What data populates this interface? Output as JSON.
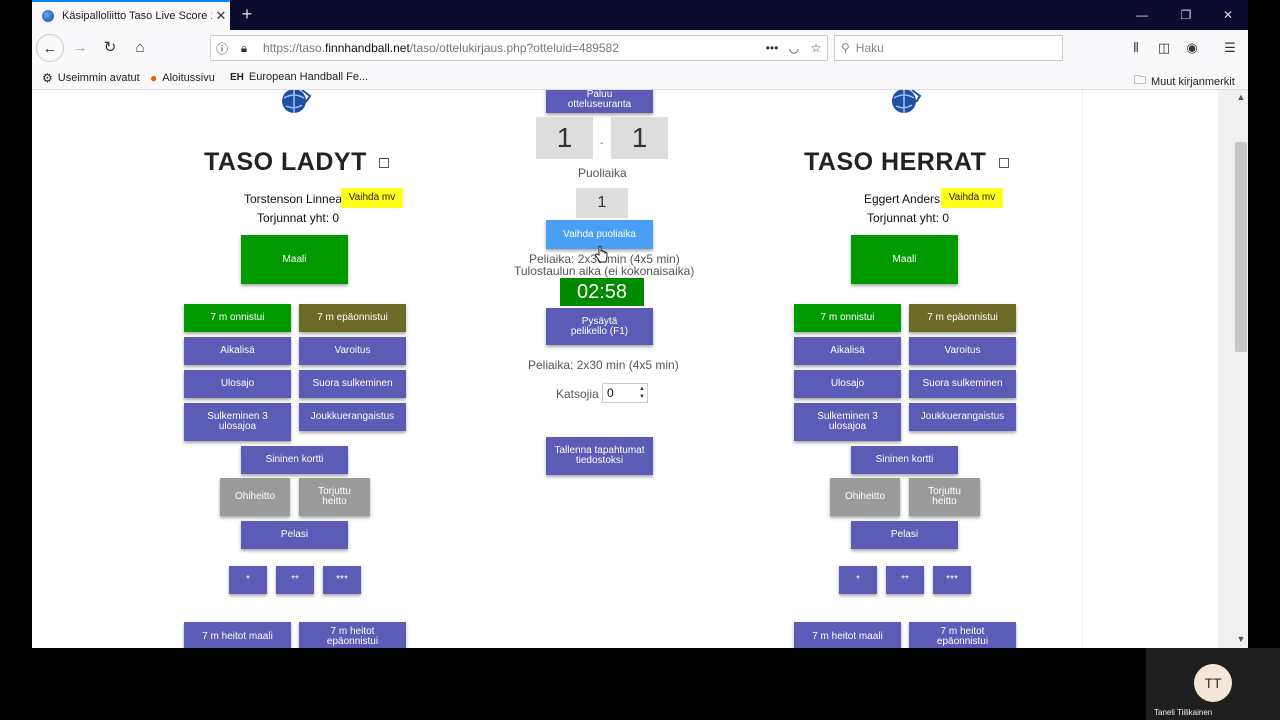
{
  "browser": {
    "tab_title": "Käsipalloliitto Taso Live Score 1",
    "url_prefix": "https://taso.",
    "url_domain": "finnhandball.net",
    "url_path": "/taso/ottelukirjaus.php?otteluid=489582",
    "search_placeholder": "Haku",
    "bookmarks": [
      "Useimmin avatut",
      "Aloitussivu",
      "European Handball Fe..."
    ],
    "other_bookmarks": "Muut kirjanmerkit"
  },
  "center": {
    "top_button": "Paluu otteluseuranta",
    "score_home": "1",
    "score_sep": "-",
    "score_away": "1",
    "period_label": "Puoliaika",
    "period_value": "1",
    "change_period": "Vaihda puoliaika",
    "game_time_info": "Peliaika: 2x30 min (4x5 min)",
    "scoreboard_time_info": "Tulostaulun aika (ei kokonaisaika)",
    "clock": "02:58",
    "stop_clock": "Pysäytä pelikello (F1)",
    "game_time_info2": "Peliaika: 2x30 min (4x5 min)",
    "spectators_label": "Katsojia",
    "spectators_value": "0",
    "save_events": "Tallenna tapahtumat tiedostoksi"
  },
  "home": {
    "name": "TASO LADYT",
    "goalie": "Torstenson Linnea",
    "change_goalie": "Vaihda mv",
    "saves": "Torjunnat yht: 0"
  },
  "away": {
    "name": "TASO HERRAT",
    "goalie": "Eggert Anders",
    "change_goalie": "Vaihda mv",
    "saves": "Torjunnat yht: 0"
  },
  "actions": {
    "goal": "Maali",
    "seven_ok": "7 m onnistui",
    "seven_fail": "7 m epäonnistui",
    "timeout": "Aikalisä",
    "warning": "Varoitus",
    "suspension": "Ulosajo",
    "direct_red": "Suora sulkeminen",
    "red_after_3": "Sulkeminen 3 ulosajoa",
    "team_penalty": "Joukkuerangaistus",
    "blue_card": "Sininen kortti",
    "miss": "Ohiheitto",
    "saved_shot": "Torjuttu heitto",
    "player": "Pelasi",
    "star1": "*",
    "star2": "**",
    "star3": "***",
    "seven_shots_goal": "7 m heitot maali",
    "seven_shots_fail": "7 m heitot epäonnistui"
  },
  "video": {
    "initials": "TT",
    "name": "Taneli Tiilikainen"
  }
}
